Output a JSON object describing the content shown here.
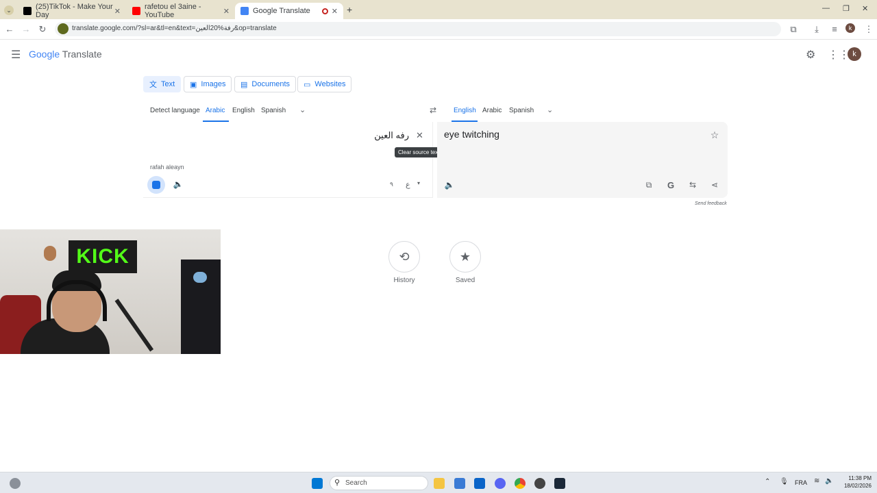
{
  "browser": {
    "tabs": [
      {
        "title": "(25)TikTok - Make Your Day",
        "color": "#000000"
      },
      {
        "title": "rafetou el 3aine - YouTube",
        "color": "#ff0000"
      },
      {
        "title": "Google Translate",
        "color": "#4285f4"
      }
    ],
    "new_tab_icon": "plus-icon",
    "url": "translate.google.com/?sl=ar&tl=en&text=رفة%20العين&op=translate",
    "profile_initial": "k"
  },
  "header": {
    "logo_google": "Google",
    "logo_translate": "Translate",
    "profile_initial": "k"
  },
  "modes": [
    {
      "label": "Text",
      "icon": "translate-icon"
    },
    {
      "label": "Images",
      "icon": "image-icon"
    },
    {
      "label": "Documents",
      "icon": "document-icon"
    },
    {
      "label": "Websites",
      "icon": "website-icon"
    }
  ],
  "source_langs": [
    "Detect language",
    "Arabic",
    "English",
    "Spanish"
  ],
  "target_langs": [
    "English",
    "Arabic",
    "Spanish"
  ],
  "source": {
    "text": "رفه العين",
    "transliteration": "rafah aleayn",
    "tooltip": "Clear source text",
    "keyboard_a": "ع",
    "keyboard_b": "٩"
  },
  "target": {
    "text": "eye twitching"
  },
  "send_feedback": "Send feedback",
  "bottom": {
    "history": "History",
    "saved": "Saved"
  },
  "webcam": {
    "sign": "KICK"
  },
  "taskbar": {
    "search": "Search",
    "lang": "FRA",
    "time": "11:38 PM",
    "date": "18/02/2026"
  },
  "colors": {
    "accent": "#1a73e8",
    "tabbar": "#e8e3cf",
    "kick_green": "#53fc18"
  }
}
